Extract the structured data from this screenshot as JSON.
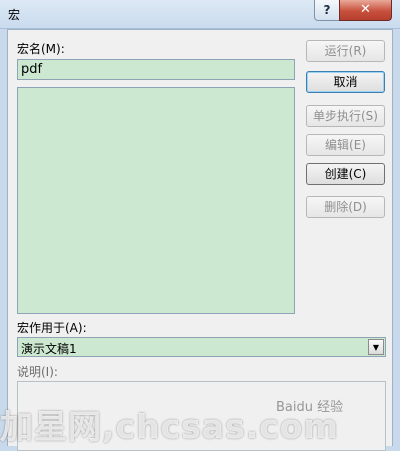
{
  "window": {
    "title": "宏",
    "help_label": "?",
    "close_label": "✕"
  },
  "macro_name": {
    "label": "宏名(M):",
    "value": "pdf"
  },
  "buttons": {
    "run": "运行(R)",
    "cancel": "取消",
    "step_into": "单步执行(S)",
    "edit": "编辑(E)",
    "create": "创建(C)",
    "delete": "删除(D)"
  },
  "macros_in": {
    "label": "宏作用于(A):",
    "selected": "演示文稿1"
  },
  "description": {
    "label": "说明(I):"
  },
  "watermark": {
    "text": "加星网,chcsas.com",
    "baidu": "Baidu 经验"
  },
  "colors": {
    "field_bg": "#cde8d0",
    "titlebar": "#c9dbee",
    "close_button": "#c8513e"
  }
}
